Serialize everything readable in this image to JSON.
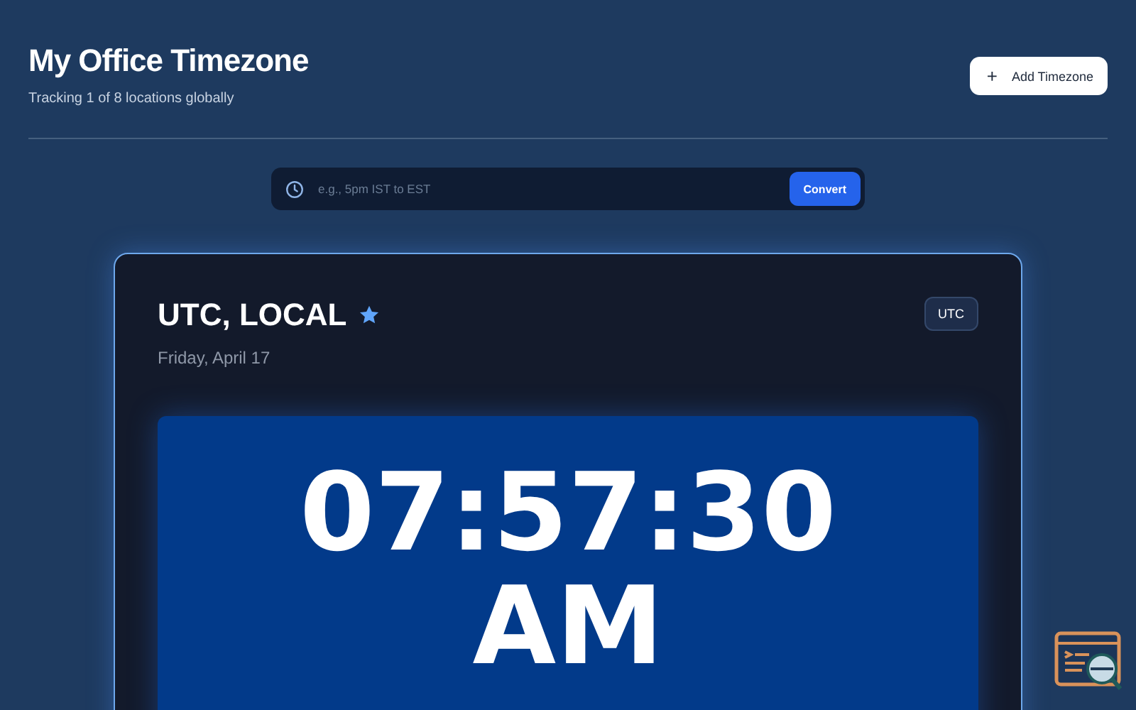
{
  "header": {
    "title": "My Office Timezone",
    "subtitle": "Tracking 1 of 8 locations globally",
    "add_button": {
      "icon": "+",
      "label": "Add Timezone"
    }
  },
  "converter": {
    "placeholder": "e.g., 5pm IST to EST",
    "button": "Convert"
  },
  "card": {
    "title": "UTC, LOCAL",
    "favorite": true,
    "date": "Friday, April 17",
    "badge": "UTC",
    "time": "07:57:30 AM"
  }
}
